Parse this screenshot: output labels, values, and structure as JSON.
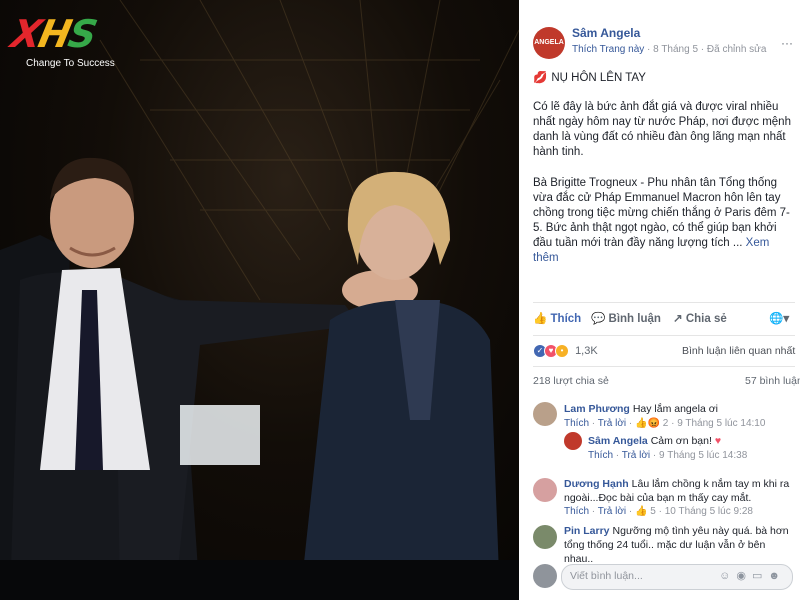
{
  "logo": {
    "x": "X",
    "h": "H",
    "s": "S",
    "tagline": "Change To Success"
  },
  "post": {
    "page_name": "Sâm Angela",
    "avatar_text": "ANGELA",
    "like_page": "Thích Trang này",
    "date": "8 Tháng 5",
    "edited": "Đã chỉnh sửa",
    "headline": "NỤ HÔN LÊN TAY",
    "paragraph1": "Có lẽ đây là bức ảnh đắt giá và được viral nhiều nhất ngày hôm nay từ nước Pháp, nơi được mệnh danh là vùng đất có nhiều đàn ông lãng mạn nhất hành tinh.",
    "paragraph2": "Bà Brigitte Trogneux - Phu nhân tân Tổng thống vừa đắc cử Pháp Emmanuel Macron hôn lên tay chồng trong tiệc mừng chiến thắng ở Paris đêm 7-5. Bức ảnh thật ngọt ngào, có thể giúp bạn khởi đầu tuần mới tràn đầy năng lượng tích ...",
    "see_more": "Xem thêm"
  },
  "actions": {
    "like": "Thích",
    "comment": "Bình luận",
    "share": "Chia sẻ"
  },
  "stats": {
    "reactions": "1,3K",
    "relevant": "Bình luận liên quan nhất",
    "shares": "218 lượt chia sẻ",
    "comments": "57 bình luận"
  },
  "comments": [
    {
      "name": "Lam Phương",
      "text": "Hay lắm angela ơi",
      "like": "Thích",
      "reply": "Trả lời",
      "reacts": "2",
      "time": "9 Tháng 5 lúc 14:10"
    },
    {
      "name": "Sâm Angela",
      "text": "Cảm ơn bạn!",
      "like": "Thích",
      "reply": "Trả lời",
      "time": "9 Tháng 5 lúc 14:38"
    },
    {
      "name": "Dương Hạnh",
      "text": "Lâu lắm chồng k nắm tay m khi ra ngoài...Đọc bài của bạn m thấy cay mắt.",
      "like": "Thích",
      "reply": "Trả lời",
      "reacts": "5",
      "time": "10 Tháng 5 lúc 9:28"
    },
    {
      "name": "Pin Larry",
      "text": "Ngưỡng mộ tình yêu này quá. bà hơn tổng thống 24 tuổi.. mặc dư luận vẫn ở bên nhau.."
    }
  ],
  "composer": {
    "placeholder": "Viết bình luận..."
  },
  "colors": {
    "link": "#365899",
    "accent": "#4267b2",
    "muted": "#90949c"
  }
}
